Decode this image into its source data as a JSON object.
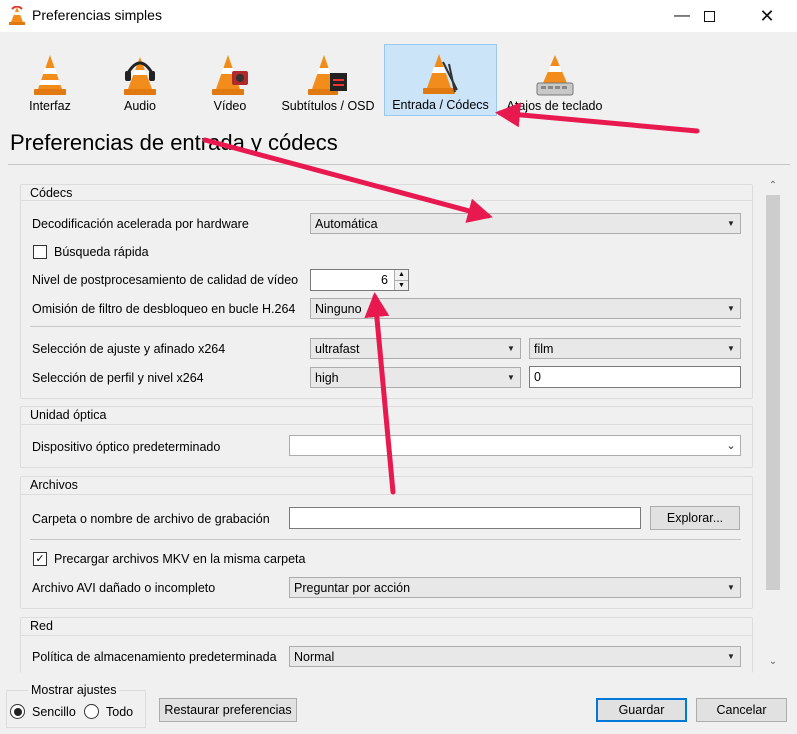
{
  "window": {
    "title": "Preferencias simples",
    "controls": [
      "minimize-icon",
      "maximize-icon",
      "close-icon"
    ]
  },
  "categories": [
    {
      "label": "Interfaz",
      "icon": "vlc-cone-icon",
      "selected": false
    },
    {
      "label": "Audio",
      "icon": "headphones-cone-icon",
      "selected": false
    },
    {
      "label": "Vídeo",
      "icon": "video-cone-icon",
      "selected": false
    },
    {
      "label": "Subtítulos / OSD",
      "icon": "subtitles-cone-icon",
      "selected": false
    },
    {
      "label": "Entrada / Códecs",
      "icon": "codecs-cone-icon",
      "selected": true
    },
    {
      "label": "Atajos de teclado",
      "icon": "hotkeys-cone-icon",
      "selected": false
    }
  ],
  "page_title": "Preferencias de entrada y códecs",
  "codecs": {
    "title": "Códecs",
    "hw_decode_label": "Decodificación acelerada por hardware",
    "hw_decode_value": "Automática",
    "fast_seek_label": "Búsqueda rápida",
    "fast_seek_checked": false,
    "postproc_label": "Nivel de postprocesamiento de calidad de vídeo",
    "postproc_value": "6",
    "deblock_label": "Omisión de filtro de desbloqueo en bucle H.264",
    "deblock_value": "Ninguno",
    "x264_preset_label": "Selección de ajuste y afinado x264",
    "x264_preset_value": "ultrafast",
    "x264_tune_value": "film",
    "x264_profile_label": "Selección de perfil y nivel x264",
    "x264_profile_value": "high",
    "x264_level_value": "0"
  },
  "optical": {
    "title": "Unidad óptica",
    "device_label": "Dispositivo óptico predeterminado",
    "device_value": ""
  },
  "files": {
    "title": "Archivos",
    "record_label": "Carpeta o nombre de archivo de grabación",
    "record_value": "",
    "browse_label": "Explorar...",
    "preload_mkv_label": "Precargar archivos MKV en la misma carpeta",
    "preload_mkv_checked": true,
    "avi_label": "Archivo AVI dañado o incompleto",
    "avi_value": "Preguntar por acción"
  },
  "network": {
    "title": "Red",
    "caching_label": "Política de almacenamiento predeterminada",
    "caching_value": "Normal"
  },
  "footer": {
    "show_settings_title": "Mostrar ajustes",
    "simple_label": "Sencillo",
    "all_label": "Todo",
    "selected_mode": "Sencillo",
    "reset_label": "Restaurar preferencias",
    "save_label": "Guardar",
    "cancel_label": "Cancelar"
  },
  "colors": {
    "selected_tab_bg": "#cce4f7",
    "annotation_arrow": "#e8194f",
    "primary_button_border": "#0078d7"
  }
}
